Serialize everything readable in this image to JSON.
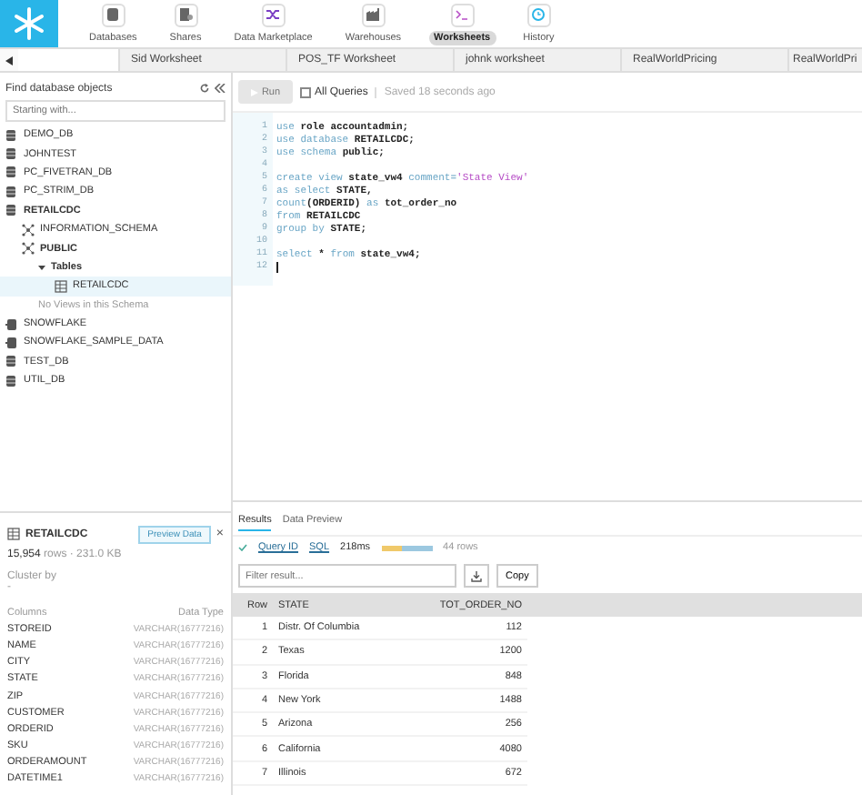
{
  "nav": [
    {
      "label": "Databases",
      "selected": false
    },
    {
      "label": "Shares",
      "selected": false
    },
    {
      "label": "Data Marketplace",
      "selected": false
    },
    {
      "label": "Warehouses",
      "selected": false
    },
    {
      "label": "Worksheets",
      "selected": true
    },
    {
      "label": "History",
      "selected": false
    }
  ],
  "worksheet_tabs": [
    {
      "selected": true
    },
    {
      "label": "Sid Worksheet",
      "selected": false
    },
    {
      "label": "POS_TF Worksheet",
      "selected": false
    },
    {
      "label": "johnk worksheet",
      "selected": false
    },
    {
      "label": "RealWorldPricing",
      "selected": false
    },
    {
      "label": "RealWorldPri",
      "selected": false
    }
  ],
  "object_browser": {
    "title": "Find database objects",
    "search_placeholder": "Starting with...",
    "tree": [
      {
        "label": "DEMO_DB",
        "kind": "database",
        "expanded": false,
        "selected": false
      },
      {
        "label": "JOHNTEST",
        "kind": "database",
        "expanded": false,
        "selected": false
      },
      {
        "label": "PC_FIVETRAN_DB",
        "kind": "database",
        "expanded": false,
        "selected": false
      },
      {
        "label": "PC_STRIM_DB",
        "kind": "database",
        "expanded": false,
        "selected": false
      },
      {
        "label": "RETAILCDC",
        "kind": "database",
        "expanded": true,
        "selected": false,
        "children": [
          {
            "label": "INFORMATION_SCHEMA",
            "kind": "schema",
            "expanded": false,
            "selected": false
          },
          {
            "label": "PUBLIC",
            "kind": "schema",
            "expanded": true,
            "selected": false,
            "children": [
              {
                "label": "Tables",
                "kind": "folder",
                "expanded": true,
                "selected": false,
                "children": [
                  {
                    "label": "RETAILCDC",
                    "kind": "table",
                    "expanded": false,
                    "selected": true
                  }
                ]
              },
              {
                "label": "No Views in this Schema",
                "kind": "note",
                "expanded": false,
                "selected": false
              }
            ]
          }
        ]
      },
      {
        "label": "SNOWFLAKE",
        "kind": "shared",
        "expanded": false,
        "selected": false
      },
      {
        "label": "SNOWFLAKE_SAMPLE_DATA",
        "kind": "shared",
        "expanded": false,
        "selected": false
      },
      {
        "label": "TEST_DB",
        "kind": "database",
        "expanded": false,
        "selected": false
      },
      {
        "label": "UTIL_DB",
        "kind": "database",
        "expanded": false,
        "selected": false
      }
    ]
  },
  "table_details": {
    "name": "RETAILCDC",
    "preview_button": "Preview Data",
    "close_button": "×",
    "row_count": "15,954",
    "rows_and_size": "rows · 231.0 KB",
    "cluster_label": "Cluster by",
    "cluster_value": "-",
    "columns_heading": "Columns",
    "type_heading": "Data Type",
    "columns": [
      {
        "name": "STOREID",
        "type": "VARCHAR(16777216)"
      },
      {
        "name": "NAME",
        "type": "VARCHAR(16777216)"
      },
      {
        "name": "CITY",
        "type": "VARCHAR(16777216)"
      },
      {
        "name": "STATE",
        "type": "VARCHAR(16777216)"
      },
      {
        "name": "ZIP",
        "type": "VARCHAR(16777216)"
      },
      {
        "name": "CUSTOMER",
        "type": "VARCHAR(16777216)"
      },
      {
        "name": "ORDERID",
        "type": "VARCHAR(16777216)"
      },
      {
        "name": "SKU",
        "type": "VARCHAR(16777216)"
      },
      {
        "name": "ORDERAMOUNT",
        "type": "VARCHAR(16777216)"
      },
      {
        "name": "DATETIME1",
        "type": "VARCHAR(16777216)"
      }
    ]
  },
  "toolbar": {
    "run_button": "Run",
    "run_disabled": true,
    "all_queries": {
      "label": "All Queries",
      "checked": false
    },
    "saved_status": "Saved 18 seconds ago"
  },
  "editor": {
    "lines": [
      {
        "number": "1",
        "tokens": [
          {
            "kind": "kw",
            "text": "use "
          },
          {
            "kind": "id",
            "text": "role accountadmin;"
          }
        ]
      },
      {
        "number": "2",
        "tokens": [
          {
            "kind": "kw",
            "text": "use database "
          },
          {
            "kind": "id",
            "text": "RETAILCDC;"
          }
        ]
      },
      {
        "number": "3",
        "tokens": [
          {
            "kind": "kw",
            "text": "use schema "
          },
          {
            "kind": "id",
            "text": "public;"
          }
        ]
      },
      {
        "number": "4"
      },
      {
        "number": "5",
        "tokens": [
          {
            "kind": "kw",
            "text": "create view "
          },
          {
            "kind": "id",
            "text": "state_vw4 "
          },
          {
            "kind": "kw",
            "text": "comment="
          },
          {
            "kind": "str",
            "text": "'State View'"
          }
        ]
      },
      {
        "number": "6",
        "tokens": [
          {
            "kind": "kw",
            "text": "as select "
          },
          {
            "kind": "id",
            "text": "STATE,"
          }
        ]
      },
      {
        "number": "7",
        "tokens": [
          {
            "kind": "kw",
            "text": "count"
          },
          {
            "kind": "id",
            "text": "(ORDERID) "
          },
          {
            "kind": "kw",
            "text": "as "
          },
          {
            "kind": "id",
            "text": "tot_order_no"
          }
        ]
      },
      {
        "number": "8",
        "tokens": [
          {
            "kind": "kw",
            "text": "from "
          },
          {
            "kind": "id",
            "text": "RETAILCDC"
          }
        ]
      },
      {
        "number": "9",
        "tokens": [
          {
            "kind": "kw",
            "text": "group by "
          },
          {
            "kind": "id",
            "text": "STATE;"
          }
        ]
      },
      {
        "number": "10"
      },
      {
        "number": "11",
        "tokens": [
          {
            "kind": "kw",
            "text": "select "
          },
          {
            "kind": "id",
            "text": "* "
          },
          {
            "kind": "kw",
            "text": "from "
          },
          {
            "kind": "id",
            "text": "state_vw4;"
          }
        ]
      },
      {
        "number": "12",
        "cursor": true
      }
    ]
  },
  "results": {
    "tabs": [
      {
        "label": "Results",
        "selected": true
      },
      {
        "label": "Data Preview",
        "selected": false
      }
    ],
    "query_id": "Query ID",
    "sql_link": "SQL",
    "duration": "218ms",
    "row_count": "44 rows",
    "filter_placeholder": "Filter result...",
    "copy_button": "Copy",
    "columns": [
      "Row",
      "STATE",
      "TOT_ORDER_NO"
    ],
    "rows": [
      [
        "1",
        "Distr. Of Columbia",
        "112"
      ],
      [
        "2",
        "Texas",
        "1200"
      ],
      [
        "3",
        "Florida",
        "848"
      ],
      [
        "4",
        "New York",
        "1488"
      ],
      [
        "5",
        "Arizona",
        "256"
      ],
      [
        "6",
        "California",
        "4080"
      ],
      [
        "7",
        "Illinois",
        "672"
      ]
    ]
  }
}
